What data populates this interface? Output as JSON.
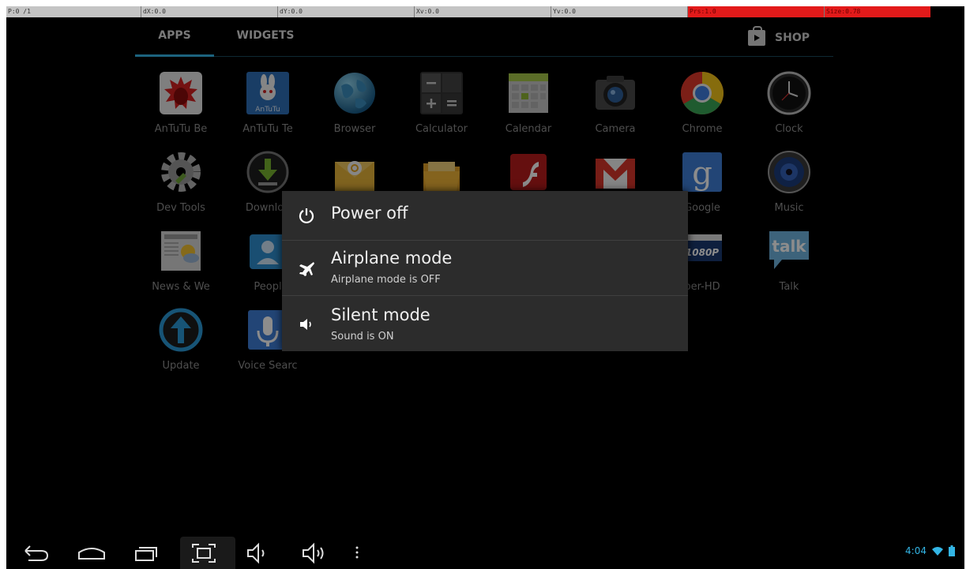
{
  "debug_bar": {
    "pointer": "P:0 /1",
    "dx": "dX:0.0",
    "dy": "dY:0.0",
    "xv": "Xv:0.0",
    "yv": "Yv:0.0",
    "pressure": "Prs:1.0",
    "size": "Size:0.78"
  },
  "tabs": {
    "apps": "APPS",
    "widgets": "WIDGETS",
    "shop": "SHOP"
  },
  "apps": [
    {
      "label": "AnTuTu Be",
      "icon": "antutu-benchmark-icon"
    },
    {
      "label": "AnTuTu Te",
      "icon": "antutu-tester-icon"
    },
    {
      "label": "Browser",
      "icon": "browser-globe-icon"
    },
    {
      "label": "Calculator",
      "icon": "calculator-icon"
    },
    {
      "label": "Calendar",
      "icon": "calendar-icon"
    },
    {
      "label": "Camera",
      "icon": "camera-icon"
    },
    {
      "label": "Chrome",
      "icon": "chrome-icon"
    },
    {
      "label": "Clock",
      "icon": "clock-icon"
    },
    {
      "label": "Dev Tools",
      "icon": "dev-tools-gear-icon"
    },
    {
      "label": "Downloa",
      "icon": "downloads-icon"
    },
    {
      "label": "",
      "icon": "email-icon"
    },
    {
      "label": "",
      "icon": "file-manager-icon"
    },
    {
      "label": "",
      "icon": "flash-player-icon"
    },
    {
      "label": "",
      "icon": "gmail-icon"
    },
    {
      "label": "Google",
      "icon": "google-search-icon"
    },
    {
      "label": "Music",
      "icon": "music-speaker-icon"
    },
    {
      "label": "News & We",
      "icon": "news-weather-icon"
    },
    {
      "label": "Peopl",
      "icon": "people-icon"
    },
    {
      "label": "per-HD",
      "icon": "hd-player-icon"
    },
    {
      "label": "Talk",
      "icon": "talk-icon"
    },
    {
      "label": "Update",
      "icon": "update-arrow-icon"
    },
    {
      "label": "Voice Searc",
      "icon": "voice-search-mic-icon"
    }
  ],
  "icon_text": {
    "antutu": "AnTuTu",
    "google": "g",
    "talk": "talk",
    "hd": "1080P"
  },
  "dialog": {
    "power_off": {
      "title": "Power off",
      "icon": "power-icon"
    },
    "airplane": {
      "title": "Airplane mode",
      "subtitle": "Airplane mode is OFF",
      "icon": "airplane-icon"
    },
    "silent": {
      "title": "Silent mode",
      "subtitle": "Sound is ON",
      "icon": "speaker-icon"
    }
  },
  "nav": {
    "buttons": [
      "back-icon",
      "home-icon",
      "recent-apps-icon",
      "screenshot-icon",
      "volume-down-icon",
      "volume-up-icon",
      "menu-icon"
    ]
  },
  "status": {
    "time": "4:04"
  },
  "colors": {
    "accent": "#33b5e5",
    "debug_highlight": "#e31a1a",
    "dialog_bg": "#2c2c2c"
  }
}
